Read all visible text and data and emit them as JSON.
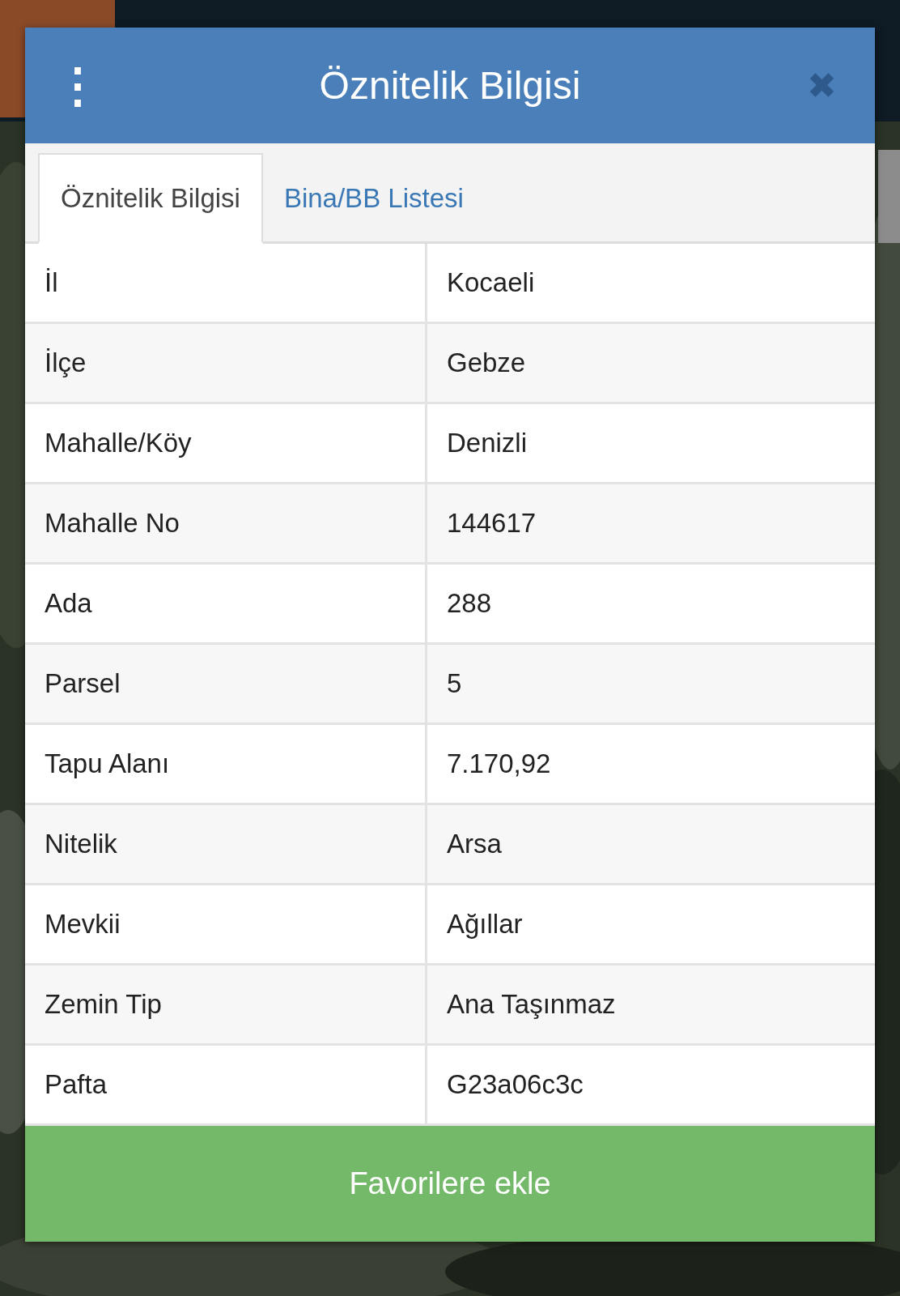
{
  "dialog": {
    "title": "Öznitelik Bilgisi",
    "menu_icon": "⋮",
    "close_icon": "✖"
  },
  "tabs": [
    {
      "label": "Öznitelik Bilgisi",
      "selected": true
    },
    {
      "label": "Bina/BB Listesi",
      "selected": false
    }
  ],
  "rows": [
    {
      "label": "İl",
      "value": "Kocaeli"
    },
    {
      "label": "İlçe",
      "value": "Gebze"
    },
    {
      "label": "Mahalle/Köy",
      "value": "Denizli"
    },
    {
      "label": "Mahalle No",
      "value": "144617"
    },
    {
      "label": "Ada",
      "value": "288"
    },
    {
      "label": "Parsel",
      "value": "5"
    },
    {
      "label": "Tapu Alanı",
      "value": "7.170,92"
    },
    {
      "label": "Nitelik",
      "value": "Arsa"
    },
    {
      "label": "Mevkii",
      "value": "Ağıllar"
    },
    {
      "label": "Zemin Tip",
      "value": "Ana Taşınmaz"
    },
    {
      "label": "Pafta",
      "value": "G23a06c3c"
    }
  ],
  "action_button": "Favorilere ekle"
}
